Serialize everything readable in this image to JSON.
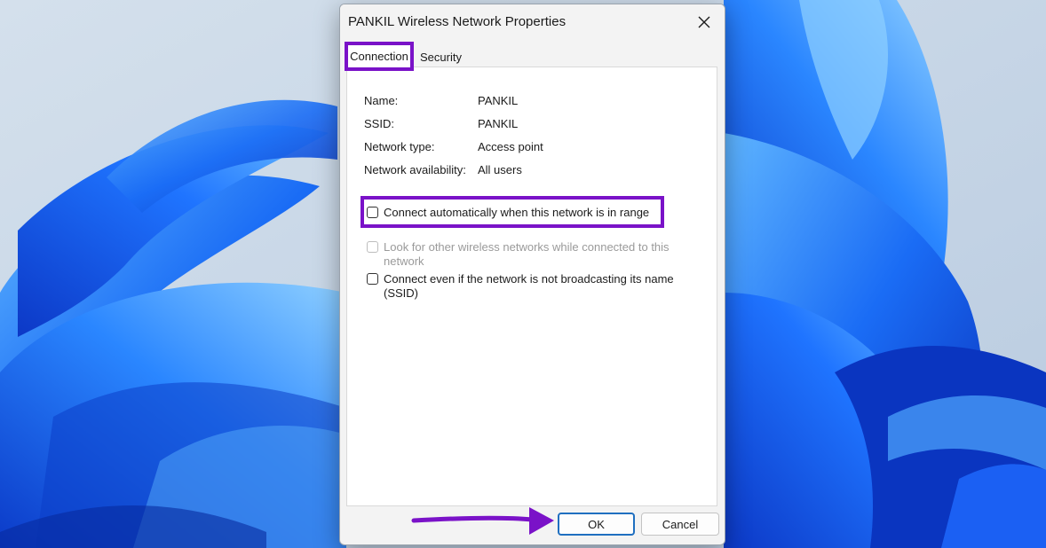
{
  "dialog": {
    "title": "PANKIL Wireless Network Properties",
    "tabs": [
      {
        "label": "Connection",
        "active": true
      },
      {
        "label": "Security",
        "active": false
      }
    ],
    "info": [
      {
        "label": "Name:",
        "value": "PANKIL"
      },
      {
        "label": "SSID:",
        "value": "PANKIL"
      },
      {
        "label": "Network type:",
        "value": "Access point"
      },
      {
        "label": "Network availability:",
        "value": "All users"
      }
    ],
    "options": [
      {
        "label": "Connect automatically when this network is in range",
        "checked": false,
        "enabled": true
      },
      {
        "label": "Look for other wireless networks while connected to this network",
        "checked": false,
        "enabled": false
      },
      {
        "label": "Connect even if the network is not broadcasting its name (SSID)",
        "checked": false,
        "enabled": true
      }
    ],
    "buttons": {
      "ok": "OK",
      "cancel": "Cancel"
    }
  },
  "colors": {
    "highlight": "#7a12c8",
    "ok_border": "#1f6fc0",
    "wallpaper_blue": "#1a5cf0",
    "wallpaper_bg": "#c8d6e6"
  },
  "icons": {
    "close": "close-icon",
    "arrow": "annotation-arrow-icon"
  }
}
